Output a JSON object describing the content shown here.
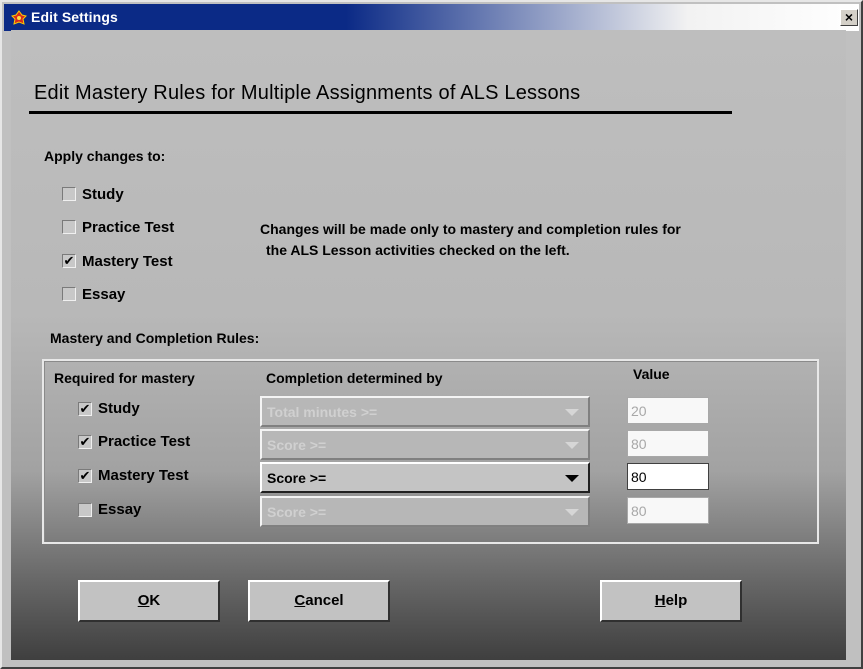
{
  "window": {
    "title": "Edit Settings",
    "close_glyph": "×"
  },
  "heading": "Edit Mastery Rules for Multiple Assignments of ALS Lessons",
  "apply": {
    "label": "Apply changes to:",
    "items": [
      {
        "label": "Study",
        "checked": false
      },
      {
        "label": "Practice Test",
        "checked": false
      },
      {
        "label": "Mastery Test",
        "checked": true
      },
      {
        "label": "Essay",
        "checked": false
      }
    ],
    "info_line1": "Changes will be made only to mastery and completion rules for",
    "info_line2": "the ALS Lesson activities checked on the left."
  },
  "rules": {
    "section_label": "Mastery and Completion Rules:",
    "col_required": "Required for mastery",
    "col_completion": "Completion determined by",
    "col_value": "Value",
    "rows": [
      {
        "label": "Study",
        "checked": true,
        "completion": "Total minutes >=",
        "value": "20",
        "enabled": false
      },
      {
        "label": "Practice Test",
        "checked": true,
        "completion": "Score >=",
        "value": "80",
        "enabled": false
      },
      {
        "label": "Mastery Test",
        "checked": true,
        "completion": "Score >=",
        "value": "80",
        "enabled": true
      },
      {
        "label": "Essay",
        "checked": false,
        "completion": "Score >=",
        "value": "80",
        "enabled": false
      }
    ]
  },
  "buttons": {
    "ok_mnemonic": "O",
    "ok_rest": "K",
    "cancel_mnemonic": "C",
    "cancel_rest": "ancel",
    "help_mnemonic": "H",
    "help_rest": "elp"
  },
  "check_glyph": "✔",
  "colors": {
    "titlebar": "#0b2a86",
    "client_top": "#bebebe",
    "client_bottom": "#3f3f3f"
  }
}
